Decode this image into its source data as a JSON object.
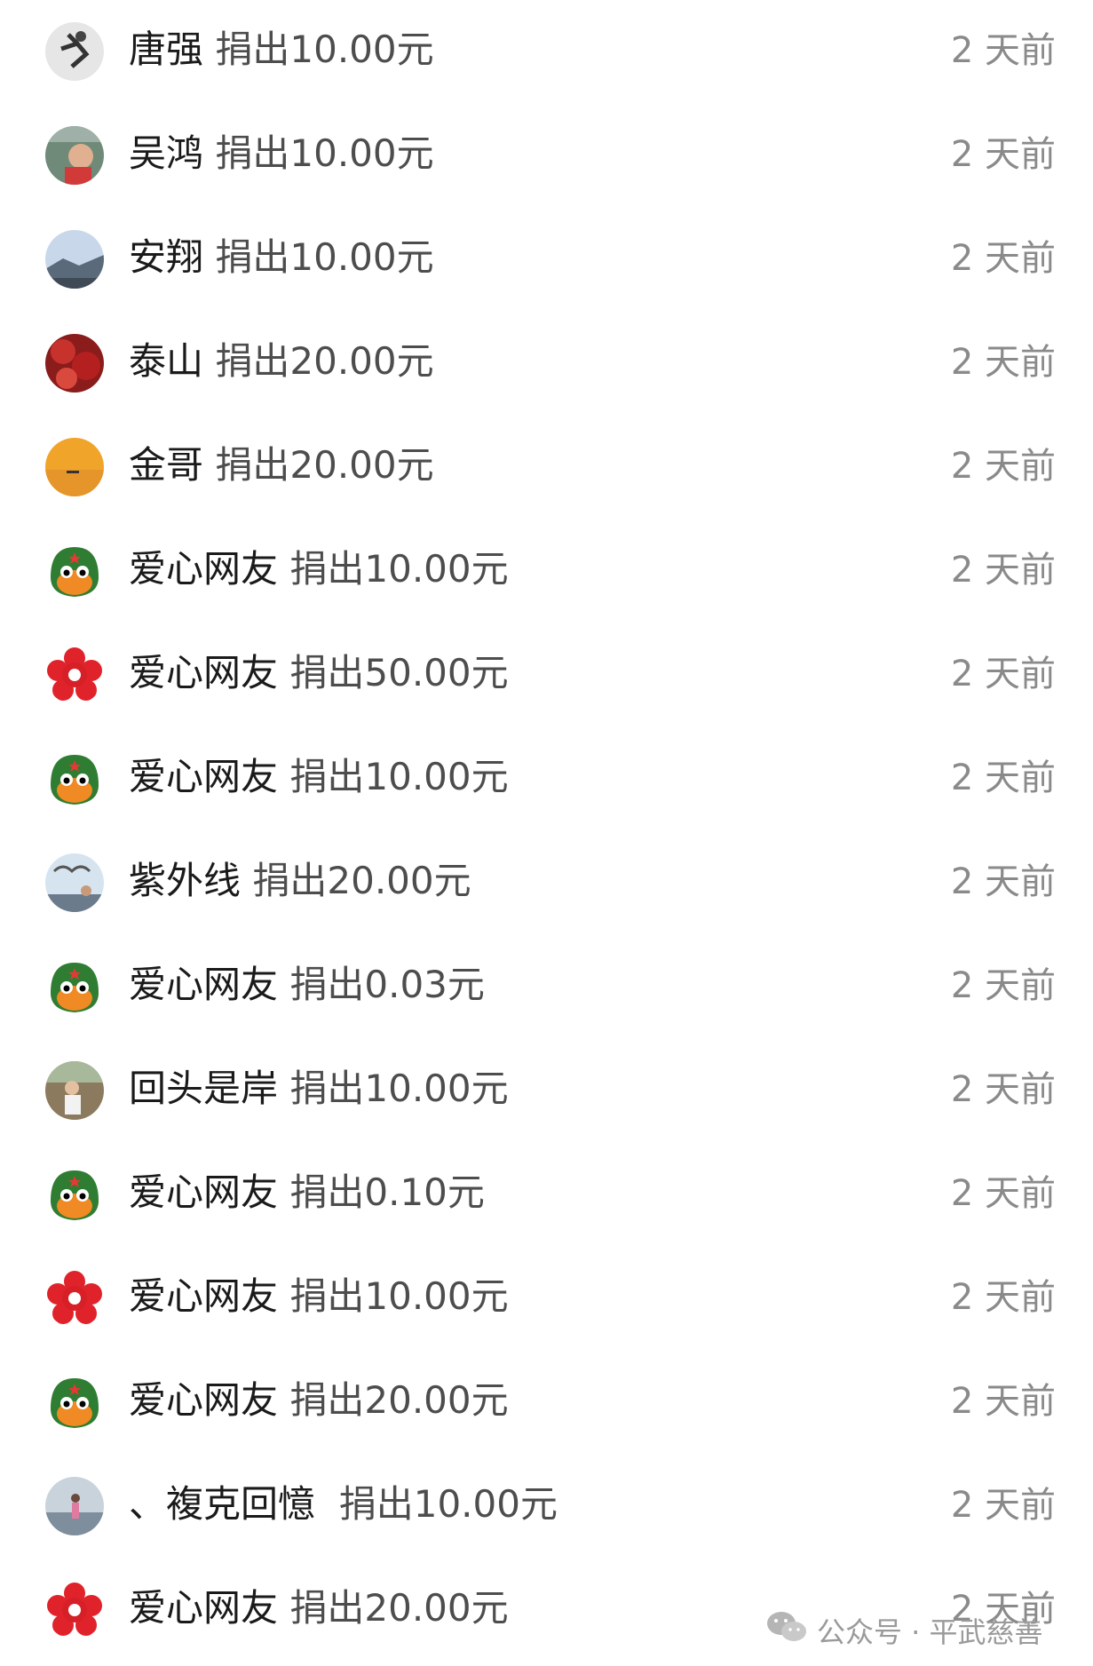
{
  "donations": [
    {
      "name": "唐强",
      "amount": "捐出10.00元",
      "time": "2 天前",
      "avatar": "runner-photo-avatar"
    },
    {
      "name": "吴鸿",
      "amount": "捐出10.00元",
      "time": "2 天前",
      "avatar": "child-photo-avatar"
    },
    {
      "name": "安翔",
      "amount": "捐出10.00元",
      "time": "2 天前",
      "avatar": "landscape-photo-avatar"
    },
    {
      "name": "泰山",
      "amount": "捐出20.00元",
      "time": "2 天前",
      "avatar": "red-leaves-avatar"
    },
    {
      "name": "金哥",
      "amount": "捐出20.00元",
      "time": "2 天前",
      "avatar": "sunset-boat-avatar"
    },
    {
      "name": "爱心网友",
      "amount": "捐出10.00元",
      "time": "2 天前",
      "avatar": "qq-penguin-avatar"
    },
    {
      "name": "爱心网友",
      "amount": "捐出50.00元",
      "time": "2 天前",
      "avatar": "red-flower-avatar"
    },
    {
      "name": "爱心网友",
      "amount": "捐出10.00元",
      "time": "2 天前",
      "avatar": "qq-penguin-avatar"
    },
    {
      "name": "紫外线",
      "amount": "捐出20.00元",
      "time": "2 天前",
      "avatar": "seagull-photo-avatar"
    },
    {
      "name": "爱心网友",
      "amount": "捐出0.03元",
      "time": "2 天前",
      "avatar": "qq-penguin-avatar"
    },
    {
      "name": "回头是岸",
      "amount": "捐出10.00元",
      "time": "2 天前",
      "avatar": "outdoor-photo-avatar"
    },
    {
      "name": "爱心网友",
      "amount": "捐出0.10元",
      "time": "2 天前",
      "avatar": "qq-penguin-avatar"
    },
    {
      "name": "爱心网友",
      "amount": "捐出10.00元",
      "time": "2 天前",
      "avatar": "red-flower-avatar"
    },
    {
      "name": "爱心网友",
      "amount": "捐出20.00元",
      "time": "2 天前",
      "avatar": "qq-penguin-avatar"
    },
    {
      "name": "、複克回憶 ",
      "amount": "捐出10.00元",
      "time": "2 天前",
      "avatar": "lake-person-avatar"
    },
    {
      "name": "爱心网友",
      "amount": "捐出20.00元",
      "time": "2 天前",
      "avatar": "red-flower-avatar"
    }
  ],
  "watermark": {
    "text": "公众号 · 平武慈善",
    "icon": "wechat-icon"
  },
  "colors": {
    "name": "#1a1a1a",
    "amount": "#4d4d4d",
    "time": "#8a8a8a",
    "background": "#ffffff"
  }
}
